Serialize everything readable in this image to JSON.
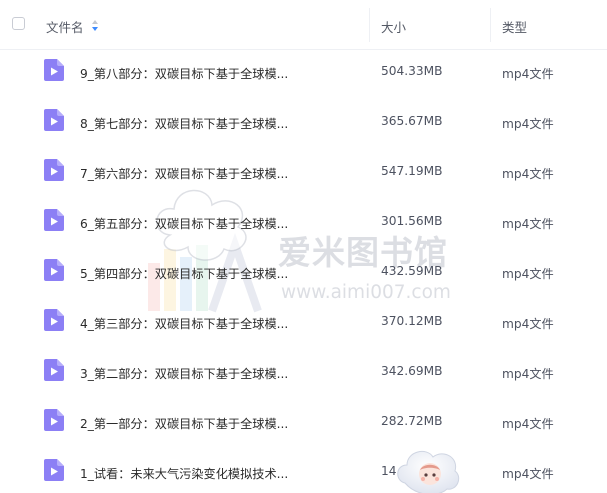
{
  "header": {
    "columns": [
      {
        "label": "文件名",
        "sortable": true
      },
      {
        "label": "大小"
      },
      {
        "label": "类型"
      }
    ]
  },
  "files": [
    {
      "name": "9_第八部分：双碳目标下基于全球模...",
      "size": "504.33MB",
      "type": "mp4文件"
    },
    {
      "name": "8_第七部分：双碳目标下基于全球模...",
      "size": "365.67MB",
      "type": "mp4文件"
    },
    {
      "name": "7_第六部分：双碳目标下基于全球模...",
      "size": "547.19MB",
      "type": "mp4文件"
    },
    {
      "name": "6_第五部分：双碳目标下基于全球模...",
      "size": "301.56MB",
      "type": "mp4文件"
    },
    {
      "name": "5_第四部分：双碳目标下基于全球模...",
      "size": "432.59MB",
      "type": "mp4文件"
    },
    {
      "name": "4_第三部分：双碳目标下基于全球模...",
      "size": "370.12MB",
      "type": "mp4文件"
    },
    {
      "name": "3_第二部分：双碳目标下基于全球模...",
      "size": "342.69MB",
      "type": "mp4文件"
    },
    {
      "name": "2_第一部分：双碳目标下基于全球模...",
      "size": "282.72MB",
      "type": "mp4文件"
    },
    {
      "name": "1_试看：未来大气污染变化模拟技术...",
      "size": "14",
      "type": "mp4文件"
    }
  ],
  "watermark": {
    "title": "爱米图书馆",
    "url": "www.aimi007.com"
  },
  "icons": {
    "file": "video-file-icon",
    "sort": "sort-arrows-icon",
    "mascot": "cloud-mascot-icon"
  },
  "colors": {
    "file_icon": "#8c7ff5",
    "sort_active": "#3d8bff",
    "text": "#2b2b2b",
    "muted": "#4d5260"
  }
}
